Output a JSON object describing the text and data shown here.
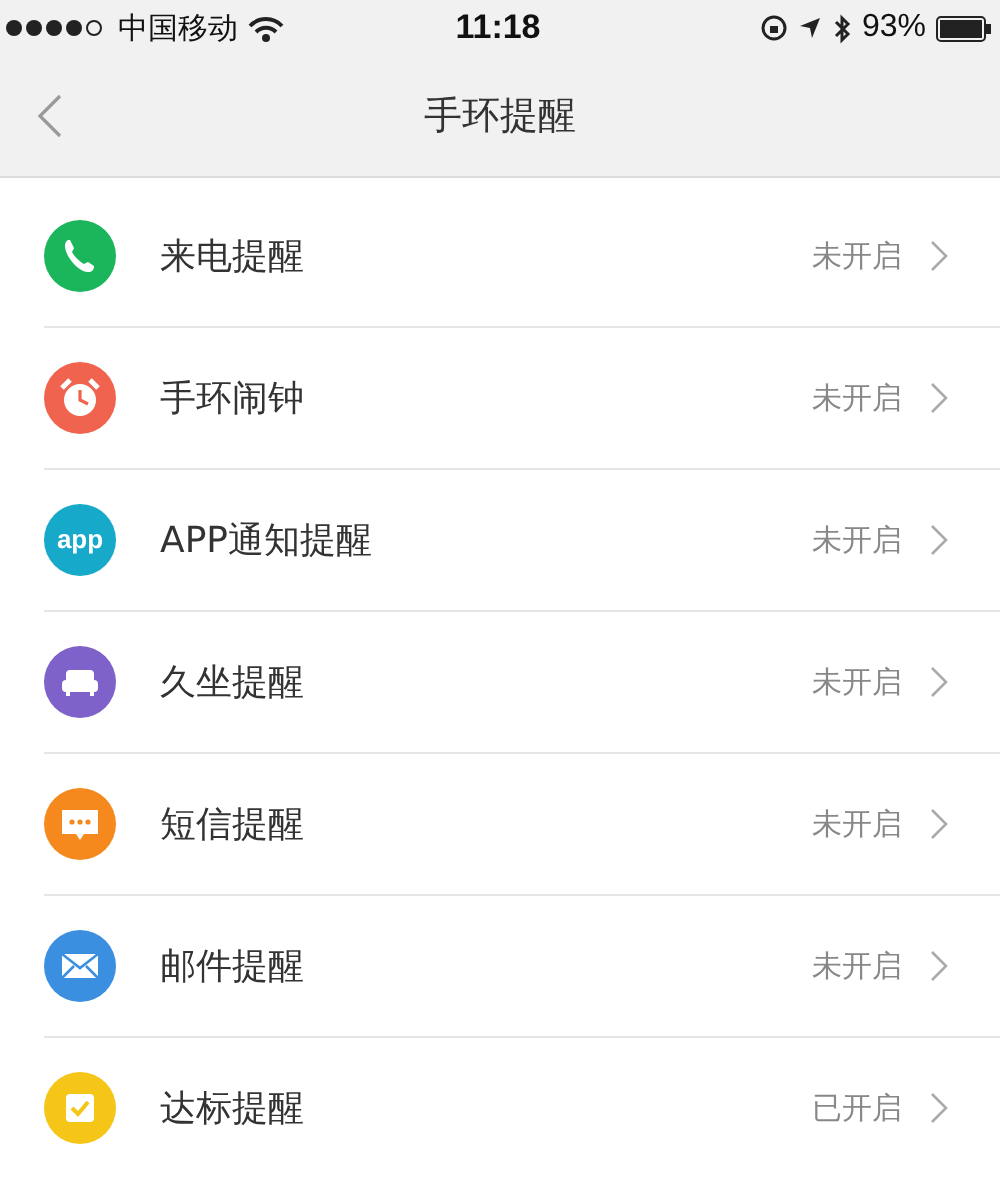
{
  "status_bar": {
    "carrier": "中国移动",
    "time": "11:18",
    "battery": "93%"
  },
  "nav": {
    "title": "手环提醒"
  },
  "items": [
    {
      "kind": "phone",
      "color": "#1bb55c",
      "label": "来电提醒",
      "status": "未开启"
    },
    {
      "kind": "alarm",
      "color": "#f0644f",
      "label": "手环闹钟",
      "status": "未开启"
    },
    {
      "kind": "app",
      "color": "#17a9c9",
      "icon_text": "app",
      "label": "APP通知提醒",
      "status": "未开启"
    },
    {
      "kind": "sofa",
      "color": "#7e62c9",
      "label": "久坐提醒",
      "status": "未开启"
    },
    {
      "kind": "message",
      "color": "#f5891e",
      "label": "短信提醒",
      "status": "未开启"
    },
    {
      "kind": "mail",
      "color": "#3b8fe0",
      "label": "邮件提醒",
      "status": "未开启"
    },
    {
      "kind": "goal",
      "color": "#f5c518",
      "label": "达标提醒",
      "status": "已开启"
    }
  ]
}
